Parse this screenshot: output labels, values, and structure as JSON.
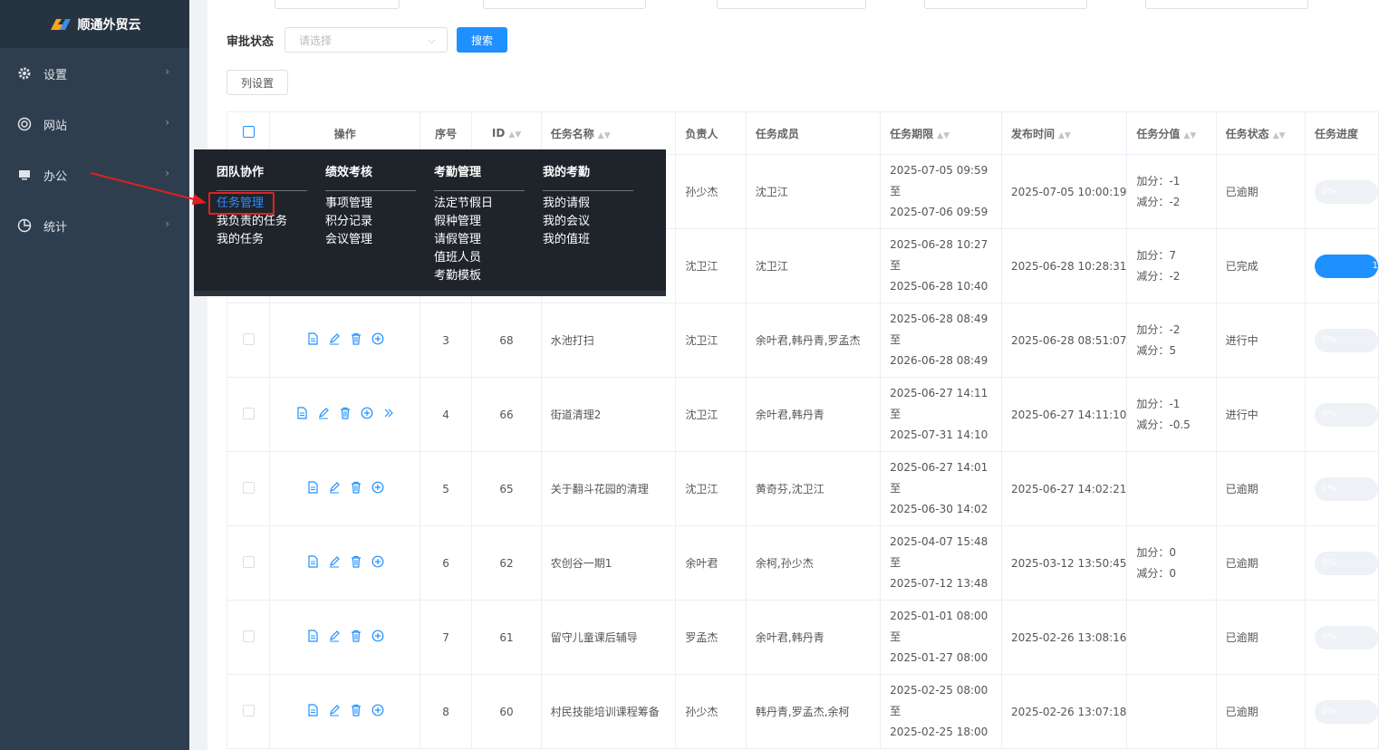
{
  "brand": {
    "name": "顺通外贸云"
  },
  "sidebar": {
    "items": [
      {
        "label": "设置",
        "icon": "gear-icon"
      },
      {
        "label": "网站",
        "icon": "globe-icon"
      },
      {
        "label": "办公",
        "icon": "monitor-icon"
      },
      {
        "label": "统计",
        "icon": "pie-chart-icon"
      }
    ]
  },
  "filter": {
    "label": "审批状态",
    "placeholder": "请选择",
    "search_label": "搜索"
  },
  "toolbar": {
    "column_settings_label": "列设置"
  },
  "table": {
    "headers": {
      "actions": "操作",
      "seq": "序号",
      "id": "ID",
      "name": "任务名称",
      "owner": "负责人",
      "members": "任务成员",
      "term": "任务期限",
      "published": "发布时间",
      "score": "任务分值",
      "status": "任务状态",
      "progress": "任务进度"
    },
    "term_separator": "至",
    "rows": [
      {
        "seq": "",
        "id": "",
        "name": "",
        "owner": "孙少杰",
        "members": "沈卫江",
        "term_start": "2025-07-05 09:59",
        "term_end": "2025-07-06 09:59",
        "published": "2025-07-05 10:00:19",
        "add": "加分：-1",
        "sub": "减分：-2",
        "status": "已逾期",
        "progress": "0%",
        "progress_value": 0
      },
      {
        "seq": "",
        "id": "",
        "name": "",
        "owner": "沈卫江",
        "members": "沈卫江",
        "term_start": "2025-06-28 10:27",
        "term_end": "2025-06-28 10:40",
        "published": "2025-06-28 10:28:31",
        "add": "加分：7",
        "sub": "减分：-2",
        "status": "已完成",
        "progress": "1",
        "progress_value": 1
      },
      {
        "seq": "3",
        "id": "68",
        "name": "水池打扫",
        "owner": "沈卫江",
        "members": "余叶君,韩丹青,罗孟杰",
        "term_start": "2025-06-28 08:49",
        "term_end": "2026-06-28 08:49",
        "published": "2025-06-28 08:51:07",
        "add": "加分：-2",
        "sub": "减分：5",
        "status": "进行中",
        "progress": "0%",
        "progress_value": 0
      },
      {
        "seq": "4",
        "id": "66",
        "name": "街道清理2",
        "owner": "沈卫江",
        "members": "余叶君,韩丹青",
        "term_start": "2025-06-27 14:11",
        "term_end": "2025-07-31 14:10",
        "published": "2025-06-27 14:11:10",
        "add": "加分：-1",
        "sub": "减分：-0.5",
        "status": "进行中",
        "progress": "0%",
        "progress_value": 0
      },
      {
        "seq": "5",
        "id": "65",
        "name": "关于翻斗花园的清理",
        "owner": "沈卫江",
        "members": "黄奇芬,沈卫江",
        "term_start": "2025-06-27 14:01",
        "term_end": "2025-06-30 14:02",
        "published": "2025-06-27 14:02:21",
        "add": "",
        "sub": "",
        "status": "已逾期",
        "progress": "0%",
        "progress_value": 0
      },
      {
        "seq": "6",
        "id": "62",
        "name": "农创谷一期1",
        "owner": "余叶君",
        "members": "余柯,孙少杰",
        "term_start": "2025-04-07 15:48",
        "term_end": "2025-07-12 13:48",
        "published": "2025-03-12 13:50:45",
        "add": "加分：0",
        "sub": "减分：0",
        "status": "已逾期",
        "progress": "0%",
        "progress_value": 0
      },
      {
        "seq": "7",
        "id": "61",
        "name": "留守儿童课后辅导",
        "owner": "罗孟杰",
        "members": "余叶君,韩丹青",
        "term_start": "2025-01-01 08:00",
        "term_end": "2025-01-27 08:00",
        "published": "2025-02-26 13:08:16",
        "add": "",
        "sub": "",
        "status": "已逾期",
        "progress": "0%",
        "progress_value": 0
      },
      {
        "seq": "8",
        "id": "60",
        "name": "村民技能培训课程筹备",
        "owner": "孙少杰",
        "members": "韩丹青,罗孟杰,余柯",
        "term_start": "2025-02-25 08:00",
        "term_end": "2025-02-25 18:00",
        "published": "2025-02-26 13:07:18",
        "add": "",
        "sub": "",
        "status": "已逾期",
        "progress": "0%",
        "progress_value": 0
      }
    ]
  },
  "mega_menu": {
    "columns": [
      {
        "title": "团队协作",
        "items": [
          "任务管理",
          "我负责的任务",
          "我的任务"
        ]
      },
      {
        "title": "绩效考核",
        "items": [
          "事项管理",
          "积分记录",
          "会议管理"
        ]
      },
      {
        "title": "考勤管理",
        "items": [
          "法定节假日",
          "假种管理",
          "请假管理",
          "值班人员",
          "考勤模板"
        ]
      },
      {
        "title": "我的考勤",
        "items": [
          "我的请假",
          "我的会议",
          "我的值班"
        ]
      }
    ],
    "active_item": "任务管理"
  },
  "colors": {
    "sidebar": "#2f3e4f",
    "accent": "#1e90ff",
    "menu_bg": "#1f242b",
    "highlight": "#e02020"
  }
}
